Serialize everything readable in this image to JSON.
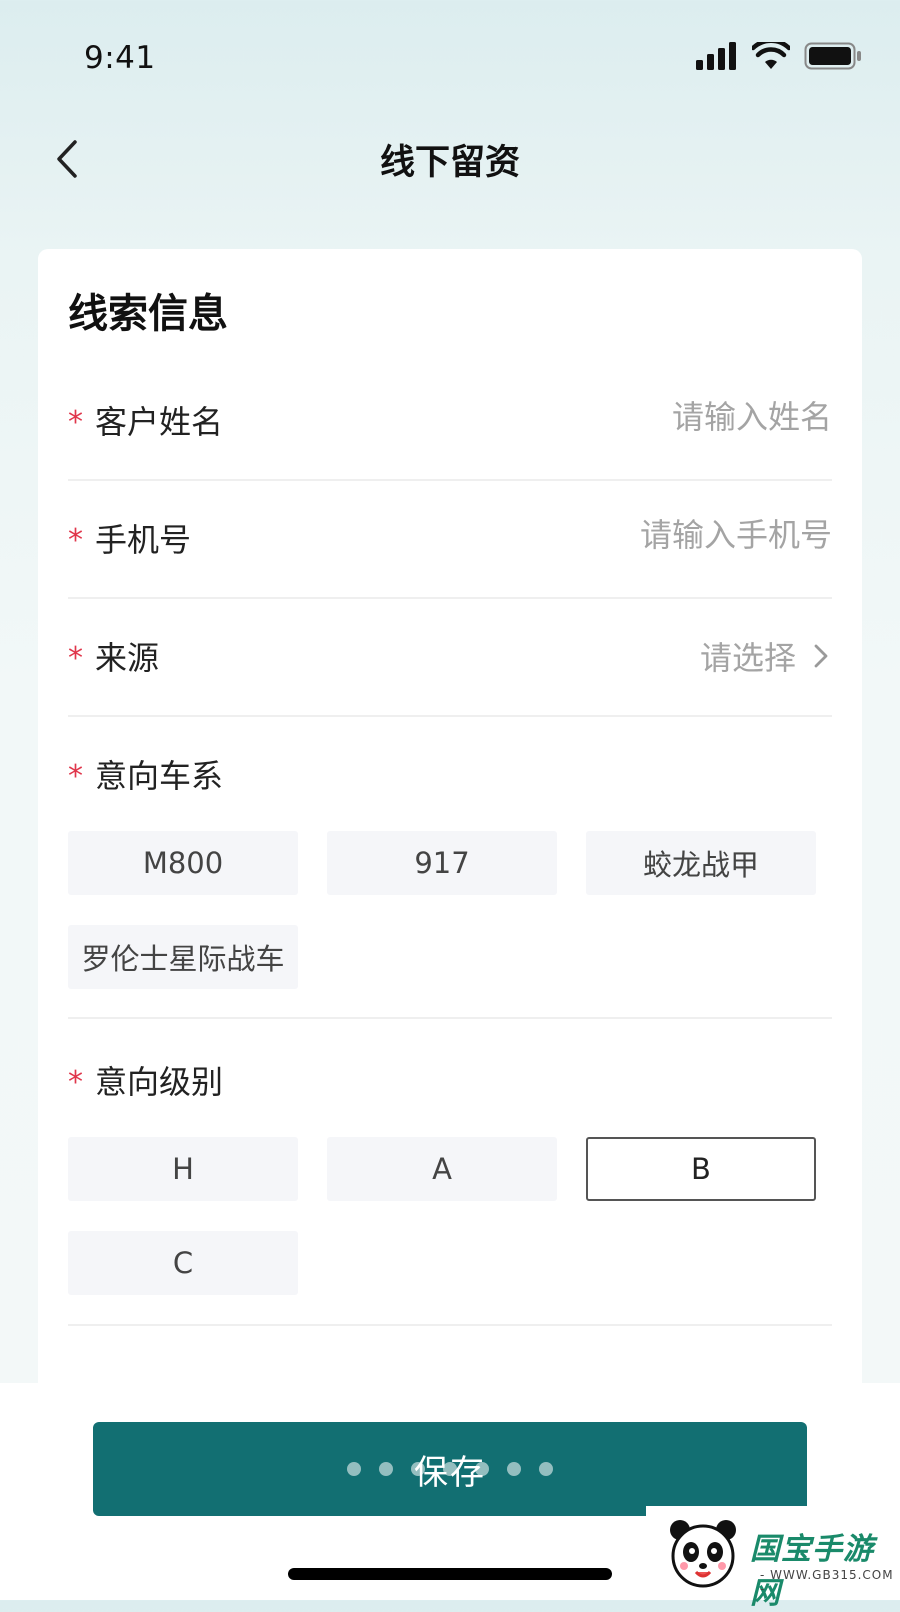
{
  "status_bar": {
    "time": "9:41",
    "icons": [
      "signal-icon",
      "wifi-icon",
      "battery-icon"
    ]
  },
  "nav": {
    "title": "线下留资",
    "back_icon": "chevron-left-icon"
  },
  "form": {
    "section_title": "线索信息",
    "required_mark": "*",
    "customer_name": {
      "label": "客户姓名",
      "placeholder": "请输入姓名",
      "value": ""
    },
    "phone": {
      "label": "手机号",
      "placeholder": "请输入手机号",
      "value": ""
    },
    "source": {
      "label": "来源",
      "value": "请选择"
    },
    "series": {
      "label": "意向车系",
      "options": [
        "M800",
        "917",
        "蛟龙战甲",
        "罗伦士星际战车"
      ]
    },
    "level": {
      "label": "意向级别",
      "options": [
        "H",
        "A",
        "B",
        "C"
      ],
      "selected": "B"
    }
  },
  "footer": {
    "save_label": "保存"
  },
  "watermark": {
    "title": "国宝手游网",
    "url": "- WWW.GB315.COM -"
  },
  "colors": {
    "primary": "#126f72",
    "required": "#e0364b",
    "placeholder": "#a4a4a4",
    "chip_bg": "#f5f6f9"
  }
}
